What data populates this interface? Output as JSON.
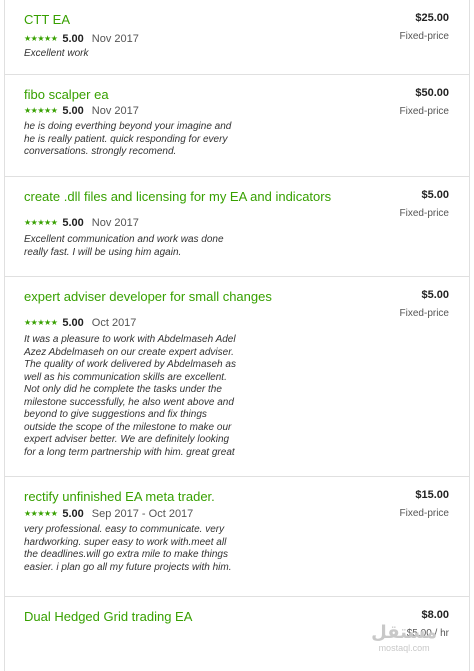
{
  "jobs": [
    {
      "title": "CTT EA",
      "stars": "★★★★★",
      "score": "5.00",
      "date": "Nov 2017",
      "review": "Excellent work",
      "price": "$25.00",
      "price_type": "Fixed-price"
    },
    {
      "title": "fibo scalper ea",
      "stars": "★★★★★",
      "score": "5.00",
      "date": "Nov 2017",
      "review": "he is doing everthing beyond your imagine and he is really patient. quick responding for every conversations. strongly recomend.",
      "price": "$50.00",
      "price_type": "Fixed-price"
    },
    {
      "title": "create .dll files and licensing for my EA and indicators",
      "stars": "★★★★★",
      "score": "5.00",
      "date": "Nov 2017",
      "review": "Excellent communication and work was done really fast. I will be using him again.",
      "price": "$5.00",
      "price_type": "Fixed-price"
    },
    {
      "title": "expert adviser developer for small changes",
      "stars": "★★★★★",
      "score": "5.00",
      "date": "Oct 2017",
      "review": "It was a pleasure to work with Abdelmaseh Adel Azez Abdelmaseh on our create expert adviser. The quality of work delivered by Abdelmaseh as well as his communication skills are excellent. Not only did he complete the tasks under the milestone successfully, he also went above and beyond to give suggestions and fix things outside the scope of the milestone to make our expert adviser better. We are definitely looking for a long term partnership with him. great great",
      "price": "$5.00",
      "price_type": "Fixed-price"
    },
    {
      "title": "rectify unfinished EA meta trader.",
      "stars": "★★★★★",
      "score": "5.00",
      "date": "Sep 2017 - Oct 2017",
      "review": "very professional. easy to communicate. very hardworking. super easy to work with.meet all the deadlines.will go extra mile to make things easier. i plan go all my future projects with him.",
      "price": "$15.00",
      "price_type": "Fixed-price"
    },
    {
      "title": "Dual Hedged Grid trading EA",
      "price": "$8.00",
      "price_type": "$5.00 / hr"
    }
  ],
  "watermark": {
    "arabic": "مستقل",
    "latin": "mostaql.com"
  },
  "colors": {
    "accent_green": "#37a000",
    "divider": "#e0e0e0"
  }
}
